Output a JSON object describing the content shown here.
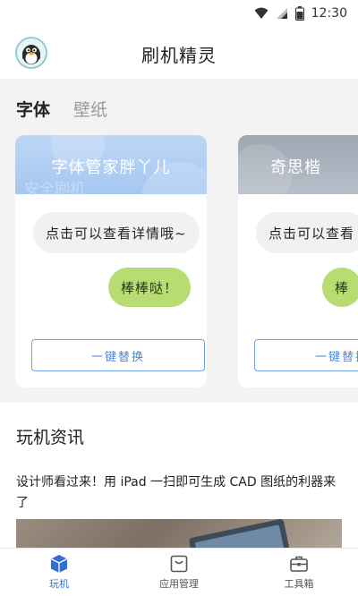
{
  "status_bar": {
    "time": "12:30"
  },
  "header": {
    "title": "刷机精灵"
  },
  "tabs": [
    {
      "label": "字体",
      "active": true
    },
    {
      "label": "壁纸",
      "active": false
    }
  ],
  "font_cards": [
    {
      "name": "字体管家胖丫儿",
      "banner_watermark": "安全刷机",
      "preview_left": "点击可以查看详情哦~",
      "preview_right": "棒棒哒！",
      "button": "一键替换"
    },
    {
      "name": "奇思楷",
      "preview_left": "点击可以查看",
      "preview_right": "棒",
      "button": "一键替换"
    }
  ],
  "news": {
    "heading": "玩机资讯",
    "items": [
      {
        "title": "设计师看过来！用 iPad 一扫即可生成 CAD 图纸的利器来了"
      }
    ]
  },
  "bottom_nav": [
    {
      "label": "玩机",
      "icon": "cube-icon",
      "active": true
    },
    {
      "label": "应用管理",
      "icon": "app-box-icon",
      "active": false
    },
    {
      "label": "工具箱",
      "icon": "toolbox-icon",
      "active": false
    }
  ],
  "colors": {
    "accent": "#2f6fd6",
    "bubble_green": "#b7dc72",
    "button_border": "#6da0e6"
  }
}
